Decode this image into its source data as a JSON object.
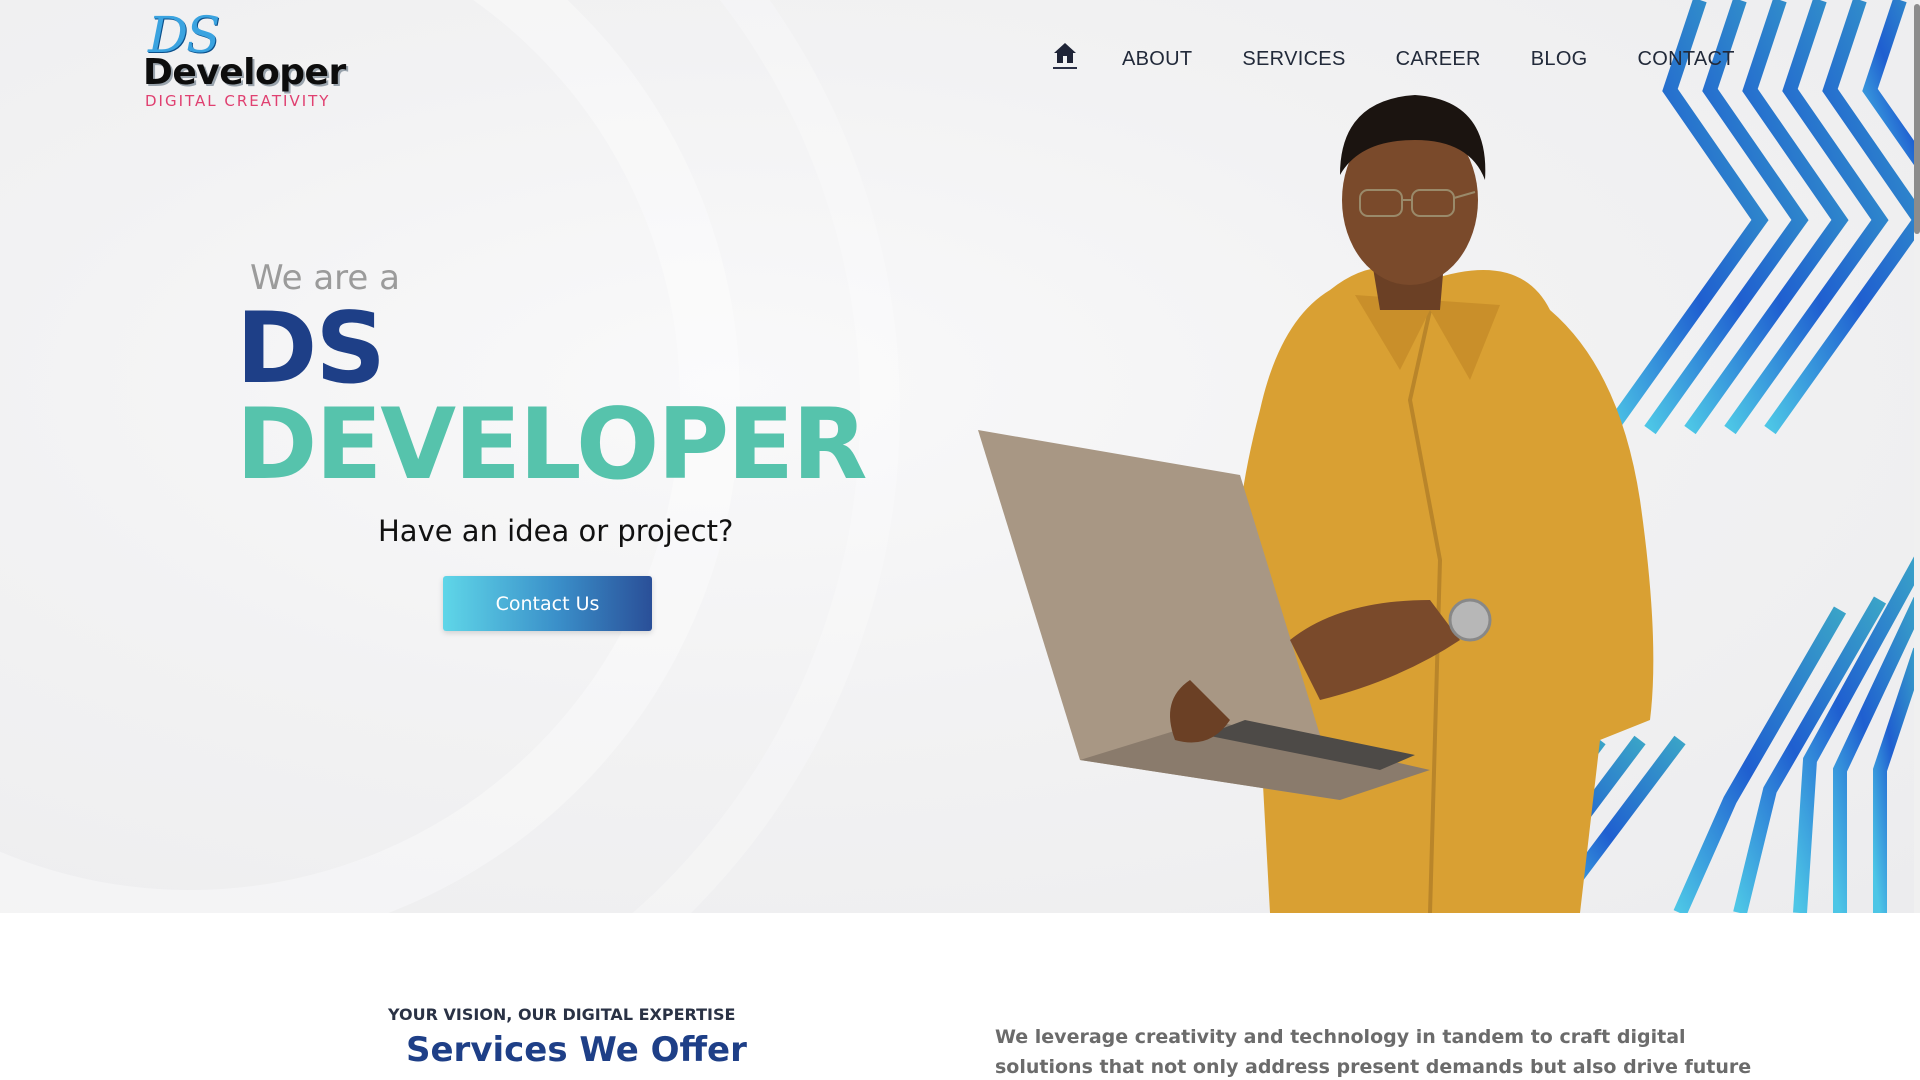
{
  "header": {
    "logo": {
      "mark": "DS",
      "name": "Developer",
      "tagline": "DIGITAL CREATIVITY"
    },
    "nav": {
      "home_icon": "home-icon",
      "items": [
        "ABOUT",
        "SERVICES",
        "CAREER",
        "BLOG",
        "CONTACT"
      ]
    }
  },
  "hero": {
    "intro": "We are a",
    "title_line1": "DS",
    "title_line2": "DEVELOPER",
    "tagline": "Have an idea or project?",
    "cta_label": "Contact Us"
  },
  "services": {
    "kicker": "YOUR VISION, OUR DIGITAL EXPERTISE",
    "title": "Services We Offer",
    "description": "We leverage creativity and technology in tandem to craft digital solutions that not only address present demands but also drive future expansion."
  },
  "colors": {
    "brand_navy": "#1e3f87",
    "brand_teal": "#56c3ac",
    "stripe_blue": "#1f5fd0",
    "stripe_cyan": "#4dc6e6",
    "shirt": "#d9a033"
  }
}
